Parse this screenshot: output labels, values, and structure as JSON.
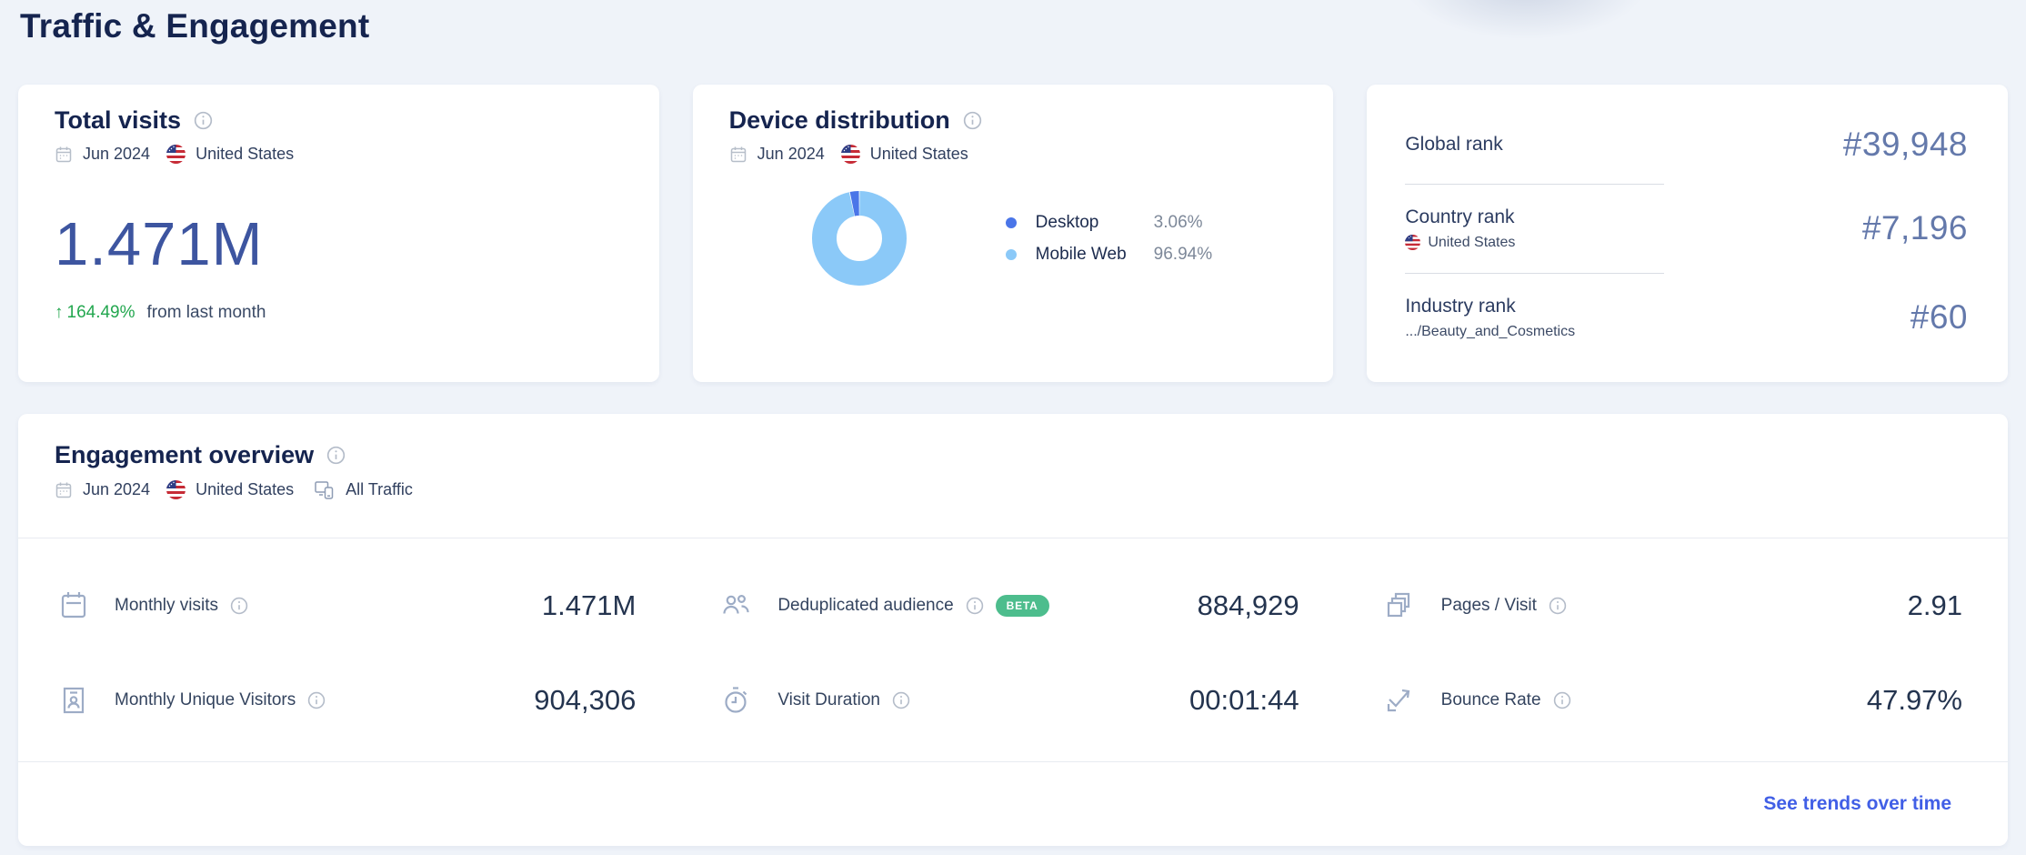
{
  "page": {
    "title": "Traffic & Engagement"
  },
  "total_visits": {
    "title": "Total visits",
    "period": "Jun 2024",
    "country": "United States",
    "value": "1.471M",
    "change_arrow": "↑",
    "change_pct": "164.49%",
    "change_note": "from last month"
  },
  "device_distribution": {
    "title": "Device distribution",
    "period": "Jun 2024",
    "country": "United States",
    "legend": [
      {
        "label": "Desktop",
        "value": "3.06%",
        "color": "#4a75e8"
      },
      {
        "label": "Mobile Web",
        "value": "96.94%",
        "color": "#8bc9f8"
      }
    ]
  },
  "rank": {
    "rows": [
      {
        "label": "Global rank",
        "value": "#39,948"
      },
      {
        "label": "Country rank",
        "sub": "United States",
        "value": "#7,196"
      },
      {
        "label": "Industry rank",
        "sub": ".../Beauty_and_Cosmetics",
        "value": "#60"
      }
    ]
  },
  "engagement": {
    "title": "Engagement overview",
    "period": "Jun 2024",
    "country": "United States",
    "traffic_filter": "All Traffic",
    "metrics": [
      {
        "label": "Monthly visits",
        "value": "1.471M",
        "icon": "calendar-icon"
      },
      {
        "label": "Deduplicated audience",
        "value": "884,929",
        "icon": "audience-icon",
        "beta": "BETA"
      },
      {
        "label": "Pages / Visit",
        "value": "2.91",
        "icon": "pages-icon"
      },
      {
        "label": "Monthly Unique Visitors",
        "value": "904,306",
        "icon": "id-card-icon"
      },
      {
        "label": "Visit Duration",
        "value": "00:01:44",
        "icon": "stopwatch-icon"
      },
      {
        "label": "Bounce Rate",
        "value": "47.97%",
        "icon": "bounce-icon"
      }
    ],
    "footer_link": "See trends over time"
  },
  "colors": {
    "accent_blue": "#415fe6",
    "positive_green": "#23a74f",
    "desktop_blue": "#4a75e8",
    "mobile_blue": "#8bc9f8",
    "heading_navy": "#15244f",
    "rank_number": "#6479ab"
  },
  "chart_data": {
    "type": "pie",
    "title": "Device distribution",
    "categories": [
      "Desktop",
      "Mobile Web"
    ],
    "values": [
      3.06,
      96.94
    ],
    "colors": [
      "#4a75e8",
      "#8bc9f8"
    ],
    "legend_position": "right",
    "donut": true
  }
}
